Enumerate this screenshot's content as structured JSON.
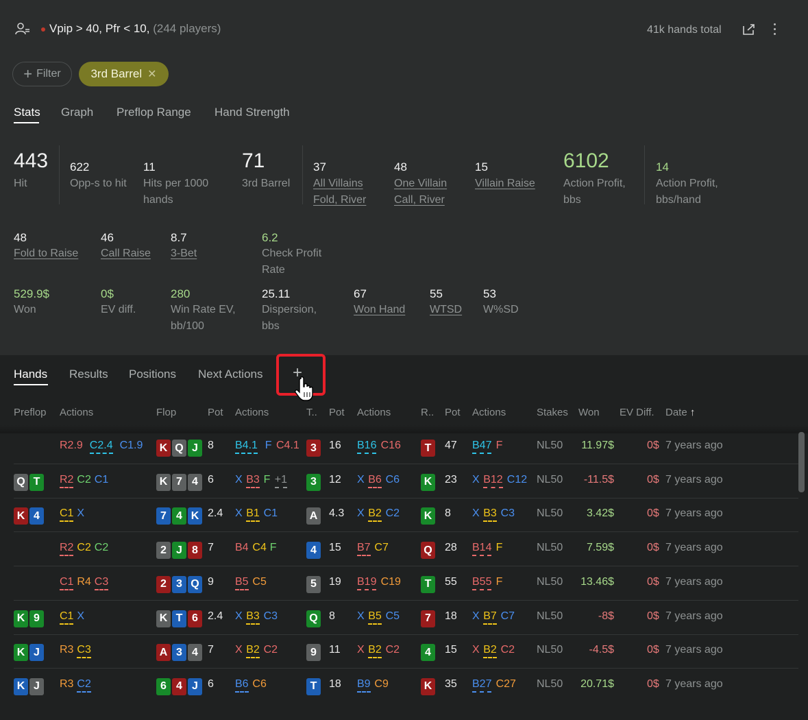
{
  "header": {
    "title": "Vpip > 40, Pfr < 10,",
    "players": "(244 players)",
    "hands_total": "41k hands total"
  },
  "filters": {
    "filter_label": "Filter",
    "chip_label": "3rd Barrel"
  },
  "tabs": [
    "Stats",
    "Graph",
    "Preflop Range",
    "Hand Strength"
  ],
  "stats_row1": [
    {
      "value": "443",
      "label": "Hit"
    },
    {
      "value": "622",
      "label": "Opp-s to hit"
    },
    {
      "value": "11",
      "label": "Hits per 1000 hands"
    },
    {
      "value": "71",
      "label": "3rd Barrel"
    },
    {
      "value": "37",
      "label": "All Villains Fold, River"
    },
    {
      "value": "48",
      "label": "One Villain Call, River"
    },
    {
      "value": "15",
      "label": "Villain Raise"
    },
    {
      "value": "6102",
      "label": "Action Profit, bbs"
    },
    {
      "value": "14",
      "label": "Action Profit, bbs/hand"
    }
  ],
  "stats_row2": [
    {
      "value": "48",
      "label": "Fold to Raise"
    },
    {
      "value": "46",
      "label": "Call Raise"
    },
    {
      "value": "8.7",
      "label": "3-Bet"
    },
    {
      "value": "6.2",
      "label": "Check Profit Rate"
    }
  ],
  "stats_row3": [
    {
      "value": "529.9$",
      "label": "Won"
    },
    {
      "value": "0$",
      "label": "EV diff."
    },
    {
      "value": "280",
      "label": "Win Rate EV, bb/100"
    },
    {
      "value": "25.11",
      "label": "Dispersion, bbs"
    },
    {
      "value": "67",
      "label": "Won Hand"
    },
    {
      "value": "55",
      "label": "WTSD"
    },
    {
      "value": "53",
      "label": "W%SD"
    }
  ],
  "bottom_tabs": [
    "Hands",
    "Results",
    "Positions",
    "Next Actions",
    "+"
  ],
  "columns": [
    "Preflop",
    "Actions",
    "Flop",
    "Pot",
    "Actions",
    "T..",
    "Pot",
    "Actions",
    "R..",
    "Pot",
    "Actions",
    "Stakes",
    "Won",
    "EV Diff.",
    "Date"
  ],
  "rows": [
    {
      "hole": [],
      "pre": [
        [
          "R2.9",
          "k-R",
          false
        ],
        [
          "C2.4",
          "k-Cc",
          true
        ],
        [
          "C1.9",
          "k-Cb",
          false
        ]
      ],
      "flop": [
        [
          "K",
          "c-red"
        ],
        [
          "Q",
          "c-gry"
        ],
        [
          "J",
          "c-grn"
        ]
      ],
      "fpot": "8",
      "fact": [
        [
          "B4.1",
          "k-Bc",
          true
        ],
        [
          "F",
          "k-Cb",
          false
        ],
        [
          "C4.1",
          "k-R",
          false
        ]
      ],
      "turn": [
        "3",
        "c-red"
      ],
      "tpot": "16",
      "tact": [
        [
          "B16",
          "k-Bc",
          true
        ],
        [
          "C16",
          "k-R",
          false
        ]
      ],
      "river": [
        "T",
        "c-red"
      ],
      "rpot": "47",
      "ract": [
        [
          "B47",
          "k-Bc",
          true
        ],
        [
          "F",
          "k-R",
          false
        ]
      ],
      "stakes": "NL50",
      "won": "11.97$",
      "neg": false,
      "ev": "0$",
      "date": "7 years ago"
    },
    {
      "hole": [
        [
          "Q",
          "c-gry"
        ],
        [
          "T",
          "c-grn"
        ]
      ],
      "pre": [
        [
          "R2",
          "k-R",
          true
        ],
        [
          "C2",
          "k-G",
          false
        ],
        [
          "C1",
          "k-Cb",
          false
        ]
      ],
      "flop": [
        [
          "K",
          "c-gry"
        ],
        [
          "7",
          "c-gry"
        ],
        [
          "4",
          "c-gry"
        ]
      ],
      "fpot": "6",
      "fact": [
        [
          "X",
          "k-X",
          false
        ],
        [
          "B3",
          "k-R",
          true
        ],
        [
          "F",
          "k-G",
          false
        ],
        [
          "+1",
          "k-P",
          true
        ]
      ],
      "turn": [
        "3",
        "c-grn"
      ],
      "tpot": "12",
      "tact": [
        [
          "X",
          "k-X",
          false
        ],
        [
          "B6",
          "k-R",
          true
        ],
        [
          "C6",
          "k-Cb",
          false
        ]
      ],
      "river": [
        "K",
        "c-grn"
      ],
      "rpot": "23",
      "ract": [
        [
          "X",
          "k-X",
          false
        ],
        [
          "B12",
          "k-R",
          true
        ],
        [
          "C12",
          "k-Cb",
          false
        ]
      ],
      "stakes": "NL50",
      "won": "-11.5$",
      "neg": true,
      "ev": "0$",
      "date": "7 years ago"
    },
    {
      "hole": [
        [
          "K",
          "c-red"
        ],
        [
          "4",
          "c-blu"
        ]
      ],
      "pre": [
        [
          "C1",
          "k-C",
          true
        ],
        [
          "X",
          "k-Cb",
          false
        ]
      ],
      "flop": [
        [
          "7",
          "c-blu"
        ],
        [
          "4",
          "c-grn"
        ],
        [
          "K",
          "c-blu"
        ]
      ],
      "fpot": "2.4",
      "fact": [
        [
          "X",
          "k-X",
          false
        ],
        [
          "B1",
          "k-C",
          true
        ],
        [
          "C1",
          "k-Cb",
          false
        ]
      ],
      "turn": [
        "A",
        "c-gry"
      ],
      "tpot": "4.3",
      "tact": [
        [
          "X",
          "k-X",
          false
        ],
        [
          "B2",
          "k-C",
          true
        ],
        [
          "C2",
          "k-Cb",
          false
        ]
      ],
      "river": [
        "K",
        "c-grn"
      ],
      "rpot": "8",
      "ract": [
        [
          "X",
          "k-X",
          false
        ],
        [
          "B3",
          "k-C",
          true
        ],
        [
          "C3",
          "k-Cb",
          false
        ]
      ],
      "stakes": "NL50",
      "won": "3.42$",
      "neg": false,
      "ev": "0$",
      "date": "7 years ago"
    },
    {
      "hole": [],
      "pre": [
        [
          "R2",
          "k-R",
          true
        ],
        [
          "C2",
          "k-C",
          false
        ],
        [
          "C2",
          "k-G",
          false
        ]
      ],
      "flop": [
        [
          "2",
          "c-gry"
        ],
        [
          "J",
          "c-grn"
        ],
        [
          "8",
          "c-red"
        ]
      ],
      "fpot": "7",
      "fact": [
        [
          "B4",
          "k-R",
          false
        ],
        [
          "C4",
          "k-C",
          false
        ],
        [
          "F",
          "k-G",
          false
        ]
      ],
      "turn": [
        "4",
        "c-blu"
      ],
      "tpot": "15",
      "tact": [
        [
          "B7",
          "k-R",
          true
        ],
        [
          "C7",
          "k-C",
          false
        ]
      ],
      "river": [
        "Q",
        "c-red"
      ],
      "rpot": "28",
      "ract": [
        [
          "B14",
          "k-R",
          true
        ],
        [
          "F",
          "k-C",
          false
        ]
      ],
      "stakes": "NL50",
      "won": "7.59$",
      "neg": false,
      "ev": "0$",
      "date": "7 years ago"
    },
    {
      "hole": [],
      "pre": [
        [
          "C1",
          "k-R",
          true
        ],
        [
          "R4",
          "k-O",
          false
        ],
        [
          "C3",
          "k-R",
          true
        ]
      ],
      "flop": [
        [
          "2",
          "c-red"
        ],
        [
          "3",
          "c-blu"
        ],
        [
          "Q",
          "c-blu"
        ]
      ],
      "fpot": "9",
      "fact": [
        [
          "B5",
          "k-R",
          true
        ],
        [
          "C5",
          "k-O",
          false
        ]
      ],
      "turn": [
        "5",
        "c-gry"
      ],
      "tpot": "19",
      "tact": [
        [
          "B19",
          "k-R",
          true
        ],
        [
          "C19",
          "k-O",
          false
        ]
      ],
      "river": [
        "T",
        "c-grn"
      ],
      "rpot": "55",
      "ract": [
        [
          "B55",
          "k-R",
          true
        ],
        [
          "F",
          "k-O",
          false
        ]
      ],
      "stakes": "NL50",
      "won": "13.46$",
      "neg": false,
      "ev": "0$",
      "date": "7 years ago"
    },
    {
      "hole": [
        [
          "K",
          "c-grn"
        ],
        [
          "9",
          "c-grn"
        ]
      ],
      "pre": [
        [
          "C1",
          "k-C",
          true
        ],
        [
          "X",
          "k-Cb",
          false
        ]
      ],
      "flop": [
        [
          "K",
          "c-gry"
        ],
        [
          "T",
          "c-blu"
        ],
        [
          "6",
          "c-red"
        ]
      ],
      "fpot": "2.4",
      "fact": [
        [
          "X",
          "k-X",
          false
        ],
        [
          "B3",
          "k-C",
          true
        ],
        [
          "C3",
          "k-Cb",
          false
        ]
      ],
      "turn": [
        "Q",
        "c-grn"
      ],
      "tpot": "8",
      "tact": [
        [
          "X",
          "k-X",
          false
        ],
        [
          "B5",
          "k-C",
          true
        ],
        [
          "C5",
          "k-Cb",
          false
        ]
      ],
      "river": [
        "7",
        "c-red"
      ],
      "rpot": "18",
      "ract": [
        [
          "X",
          "k-X",
          false
        ],
        [
          "B7",
          "k-C",
          true
        ],
        [
          "C7",
          "k-Cb",
          false
        ]
      ],
      "stakes": "NL50",
      "won": "-8$",
      "neg": true,
      "ev": "0$",
      "date": "7 years ago"
    },
    {
      "hole": [
        [
          "K",
          "c-grn"
        ],
        [
          "J",
          "c-blu"
        ]
      ],
      "pre": [
        [
          "R3",
          "k-O",
          false
        ],
        [
          "C3",
          "k-C",
          true
        ]
      ],
      "flop": [
        [
          "A",
          "c-red"
        ],
        [
          "3",
          "c-blu"
        ],
        [
          "4",
          "c-gry"
        ]
      ],
      "fpot": "7",
      "fact": [
        [
          "X",
          "k-XR",
          false
        ],
        [
          "B2",
          "k-C",
          true
        ],
        [
          "C2",
          "k-R",
          false
        ]
      ],
      "turn": [
        "9",
        "c-gry"
      ],
      "tpot": "11",
      "tact": [
        [
          "X",
          "k-XR",
          false
        ],
        [
          "B2",
          "k-C",
          true
        ],
        [
          "C2",
          "k-R",
          false
        ]
      ],
      "river": [
        "4",
        "c-grn"
      ],
      "rpot": "15",
      "ract": [
        [
          "X",
          "k-XR",
          false
        ],
        [
          "B2",
          "k-C",
          true
        ],
        [
          "C2",
          "k-R",
          false
        ]
      ],
      "stakes": "NL50",
      "won": "-4.5$",
      "neg": true,
      "ev": "0$",
      "date": "7 years ago"
    },
    {
      "hole": [
        [
          "K",
          "c-blu"
        ],
        [
          "J",
          "c-gry"
        ]
      ],
      "pre": [
        [
          "R3",
          "k-O",
          false
        ],
        [
          "C2",
          "k-Cb",
          true
        ]
      ],
      "flop": [
        [
          "6",
          "c-grn"
        ],
        [
          "4",
          "c-red"
        ],
        [
          "J",
          "c-blu"
        ]
      ],
      "fpot": "6",
      "fact": [
        [
          "B6",
          "k-Cb",
          true
        ],
        [
          "C6",
          "k-O",
          false
        ]
      ],
      "turn": [
        "T",
        "c-blu"
      ],
      "tpot": "18",
      "tact": [
        [
          "B9",
          "k-Cb",
          true
        ],
        [
          "C9",
          "k-O",
          false
        ]
      ],
      "river": [
        "K",
        "c-red"
      ],
      "rpot": "35",
      "ract": [
        [
          "B27",
          "k-Cb",
          true
        ],
        [
          "C27",
          "k-O",
          false
        ]
      ],
      "stakes": "NL50",
      "won": "20.71$",
      "neg": false,
      "ev": "0$",
      "date": "7 years ago"
    }
  ]
}
